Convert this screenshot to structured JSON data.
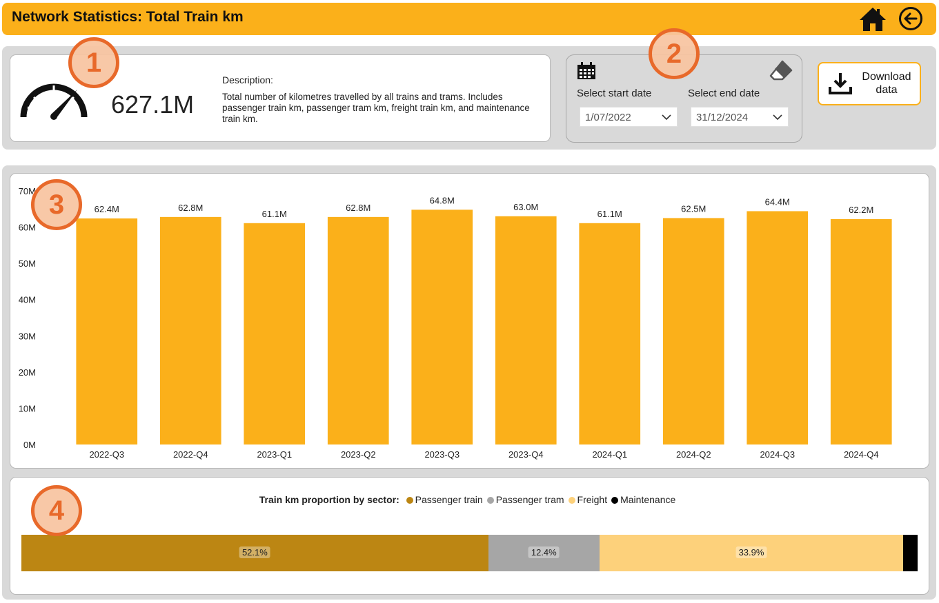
{
  "header": {
    "title": "Network Statistics: Total Train km",
    "home_icon": "home-icon",
    "back_icon": "back-arrow-icon",
    "color": "#FBB01A"
  },
  "kpi": {
    "value": "627.1M",
    "description_label": "Description:",
    "description": "Total number of kilometres travelled by all trains and trams. Includes passenger train km, passenger tram km, freight train km, and maintenance train km.",
    "icon": "speedometer-icon"
  },
  "date_filter": {
    "start_label": "Select start date",
    "start_value": "1/07/2022",
    "end_label": "Select end date",
    "end_value": "31/12/2024",
    "calendar_icon": "calendar-icon",
    "clear_icon": "eraser-icon"
  },
  "download": {
    "label": "Download data",
    "icon": "download-icon"
  },
  "callouts": [
    "1",
    "2",
    "3",
    "4"
  ],
  "chart_data": [
    {
      "type": "bar",
      "categories": [
        "2022-Q3",
        "2022-Q4",
        "2023-Q1",
        "2023-Q2",
        "2023-Q3",
        "2023-Q4",
        "2024-Q1",
        "2024-Q2",
        "2024-Q3",
        "2024-Q4"
      ],
      "values": [
        62.4,
        62.8,
        61.1,
        62.8,
        64.8,
        63.0,
        61.1,
        62.5,
        64.4,
        62.2
      ],
      "value_labels": [
        "62.4M",
        "62.8M",
        "61.1M",
        "62.8M",
        "64.8M",
        "63.0M",
        "61.1M",
        "62.5M",
        "64.4M",
        "62.2M"
      ],
      "y_ticks": [
        0,
        10,
        20,
        30,
        40,
        50,
        60,
        70
      ],
      "y_tick_labels": [
        "0M",
        "10M",
        "20M",
        "30M",
        "40M",
        "50M",
        "60M",
        "70M"
      ],
      "ylim": [
        0,
        70
      ],
      "grid": false,
      "color": "#FBB01A"
    },
    {
      "type": "bar",
      "stacked": true,
      "orientation": "horizontal",
      "title": "Train km proportion by sector:",
      "series": [
        {
          "name": "Passenger train",
          "value": 52.1,
          "label": "52.1%",
          "color": "#BC8613"
        },
        {
          "name": "Passenger tram",
          "value": 12.4,
          "label": "12.4%",
          "color": "#A6A6A6"
        },
        {
          "name": "Freight",
          "value": 33.9,
          "label": "33.9%",
          "color": "#FDD17B"
        },
        {
          "name": "Maintenance",
          "value": 1.6,
          "label": "",
          "color": "#000000"
        }
      ],
      "legend": "top"
    }
  ]
}
